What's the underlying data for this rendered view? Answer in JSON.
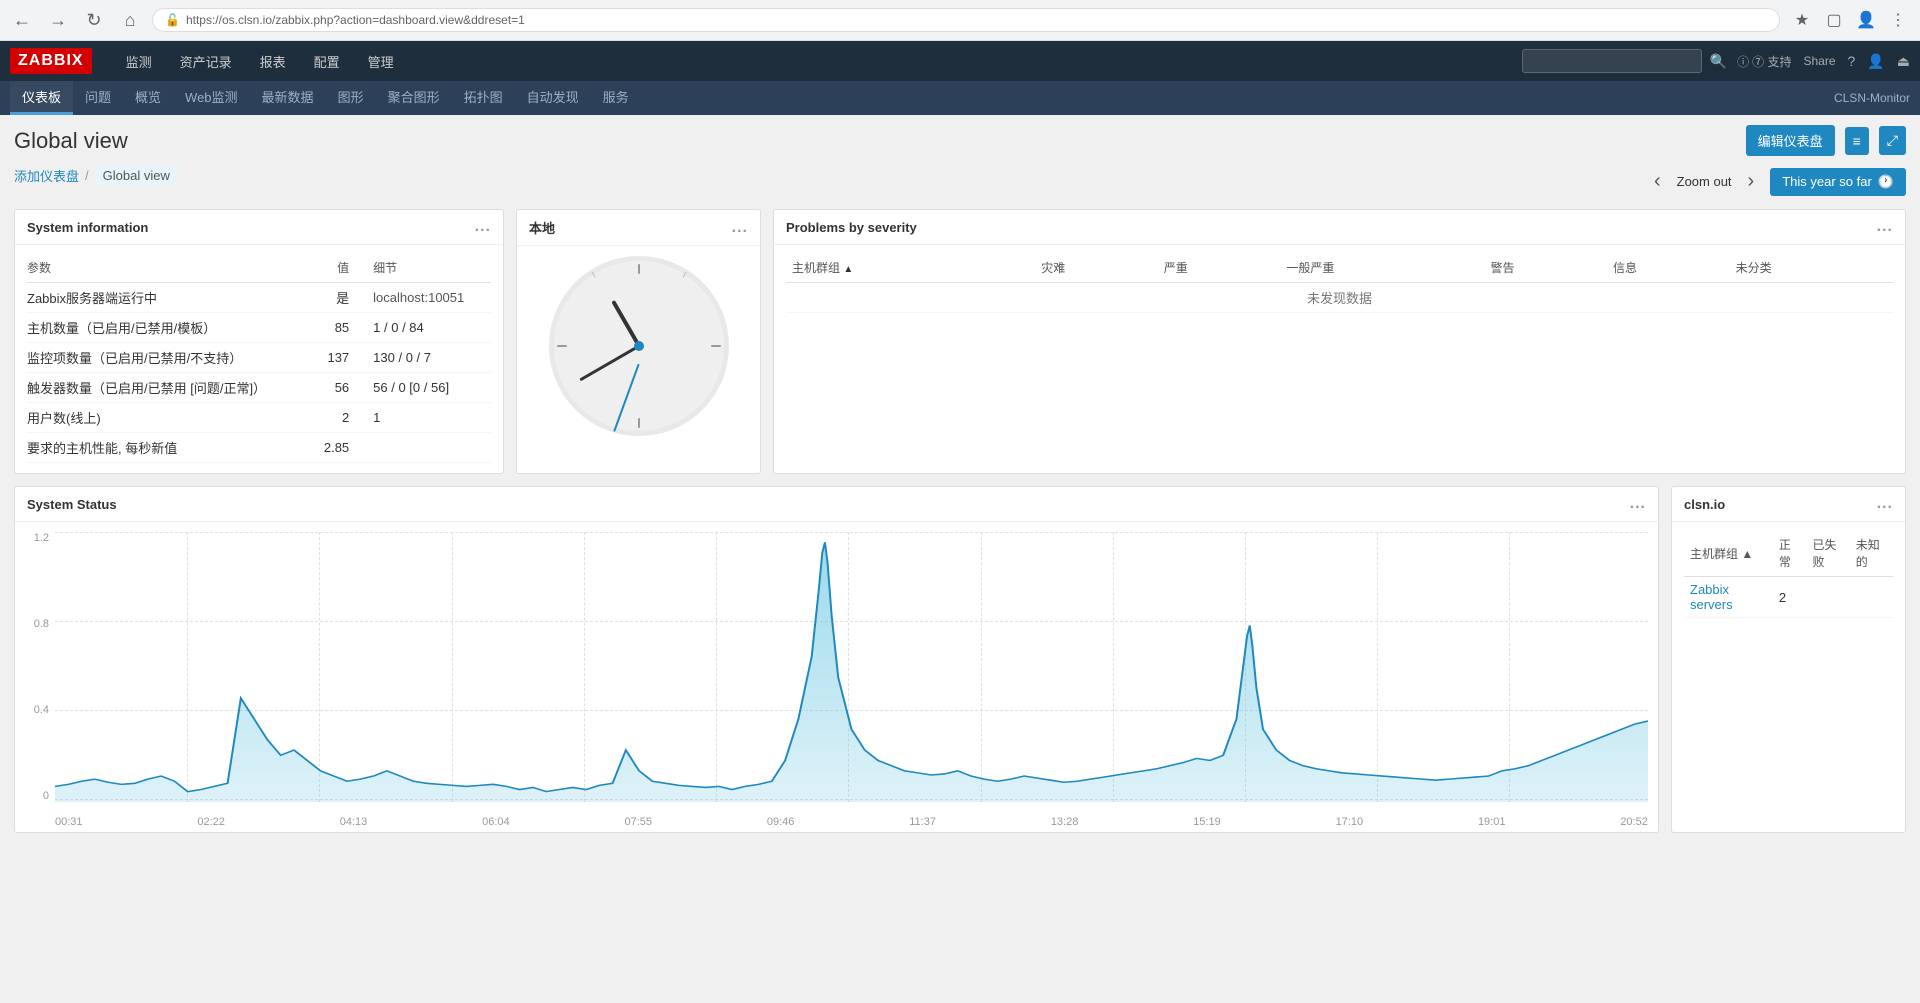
{
  "browser": {
    "url": "https://os.clsn.io/zabbix.php?action=dashboard.view&ddreset=1",
    "back_title": "Back",
    "forward_title": "Forward",
    "reload_title": "Reload",
    "home_title": "Home"
  },
  "topnav": {
    "logo": "ZABBIX",
    "menu_items": [
      "监测",
      "资产记录",
      "报表",
      "配置",
      "管理"
    ],
    "search_placeholder": "",
    "support_label": "⑦ 支持",
    "share_label": "Share",
    "user_icon": "👤",
    "power_icon": "⏻"
  },
  "subnav": {
    "items": [
      "仪表板",
      "问题",
      "概览",
      "Web监测",
      "最新数据",
      "图形",
      "聚合图形",
      "拓扑图",
      "自动发现",
      "服务"
    ],
    "active": "仪表板",
    "right_label": "CLSN-Monitor"
  },
  "page": {
    "title": "Global view",
    "breadcrumb_home": "添加仪表盘",
    "breadcrumb_current": "Global view",
    "edit_button": "编辑仪表盘",
    "list_icon": "≡",
    "expand_icon": "⤢"
  },
  "zoom": {
    "prev_label": "‹",
    "next_label": "›",
    "zoom_out_label": "Zoom out",
    "this_year_label": "This year so far",
    "clock_icon": "🕐"
  },
  "sysinfo": {
    "title": "System information",
    "menu": "...",
    "col_param": "参数",
    "col_value": "值",
    "col_detail": "细节",
    "rows": [
      {
        "param": "Zabbix服务器端运行中",
        "value": "是",
        "detail": "localhost:10051",
        "value_class": "text-green"
      },
      {
        "param": "主机数量（已启用/已禁用/模板）",
        "value": "85",
        "detail": "1 / 0 / 84",
        "detail_class": "text-blue"
      },
      {
        "param": "监控项数量（已启用/已禁用/不支持）",
        "value": "137",
        "detail": "130 / 0 / 7",
        "detail_class": "text-orange"
      },
      {
        "param": "触发器数量（已启用/已禁用 [问题/正常]）",
        "value": "56",
        "detail": "56 / 0 [0 / 56]",
        "detail_class": "text-blue"
      },
      {
        "param": "用户数(线上)",
        "value": "2",
        "detail": "1",
        "detail_class": "text-green"
      },
      {
        "param": "要求的主机性能, 每秒新值",
        "value": "2.85",
        "detail": "",
        "detail_class": ""
      }
    ]
  },
  "clock": {
    "title": "本地",
    "menu": "...",
    "hour_rotation": 330,
    "minute_rotation": 40,
    "second_rotation": 200
  },
  "problems": {
    "title": "Problems by severity",
    "menu": "...",
    "col_hostgroup": "主机群组",
    "col_disaster": "灾难",
    "col_severe": "严重",
    "col_general": "一般严重",
    "col_warning": "警告",
    "col_info": "信息",
    "col_unclassified": "未分类",
    "no_data": "未发现数据"
  },
  "system_status": {
    "title": "System Status",
    "menu": "...",
    "y_labels": [
      "1.2",
      "0.8",
      "0.4",
      "0"
    ],
    "x_labels": [
      "00:31",
      "02:22",
      "04:13",
      "06:04",
      "07:55",
      "09:46",
      "11:37",
      "13:28",
      "15:19",
      "17:10",
      "19:01",
      "20:52"
    ]
  },
  "clsn": {
    "title": "clsn.io",
    "menu": "...",
    "col_hostgroup": "主机群组",
    "col_normal": "正常",
    "col_failed": "已失败",
    "col_unknown": "未知的",
    "rows": [
      {
        "name": "Zabbix servers",
        "normal": "2",
        "failed": "",
        "unknown": ""
      }
    ]
  }
}
